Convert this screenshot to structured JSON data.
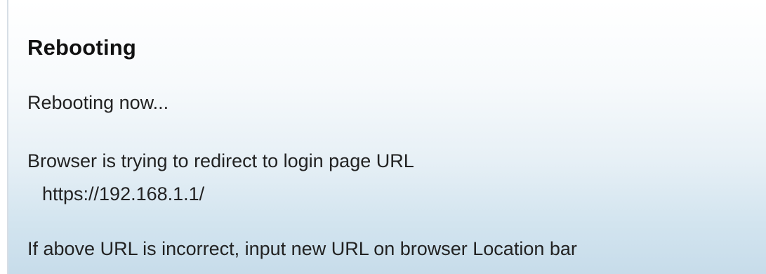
{
  "page": {
    "title": "Rebooting",
    "status": "Rebooting now...",
    "redirect_message": "Browser is trying to redirect to login page URL",
    "redirect_url": "https://192.168.1.1/",
    "instruction": "If above URL is incorrect, input new URL on browser Location bar"
  }
}
